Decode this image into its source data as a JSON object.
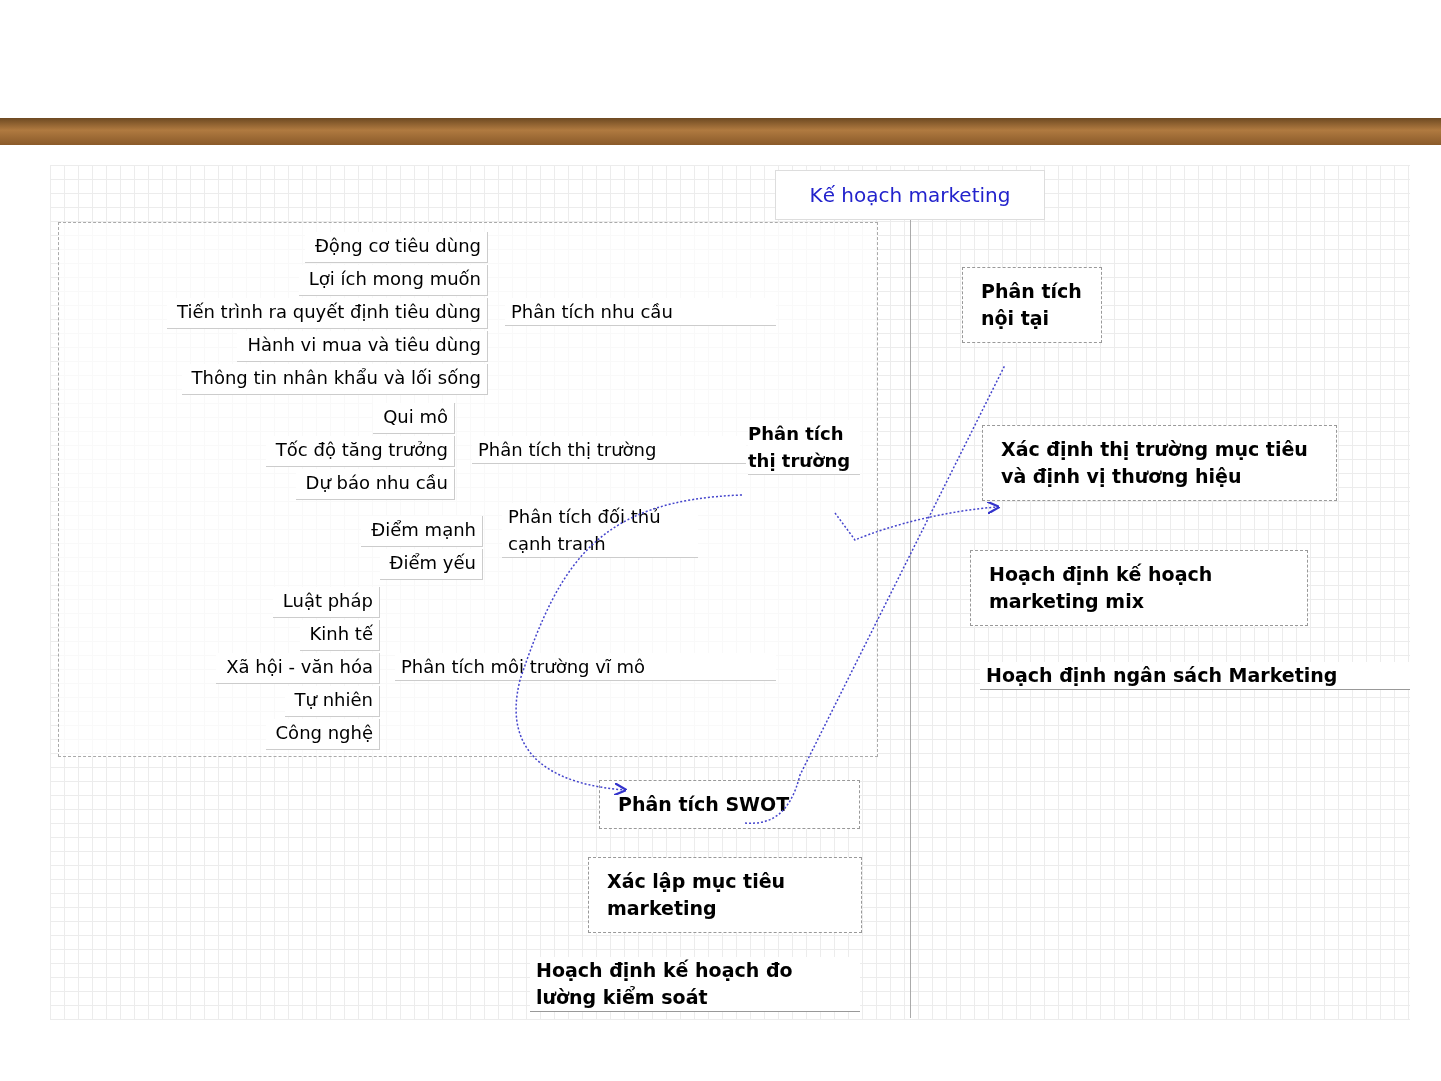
{
  "root": {
    "title": "Kế hoạch marketing"
  },
  "market_analysis": {
    "label": "Phân tích thị trường",
    "branches": [
      {
        "label": "Phân tích nhu cầu",
        "children": [
          "Động cơ tiêu dùng",
          "Lợi ích mong muốn",
          "Tiến trình ra quyết định tiêu dùng",
          "Hành vi mua và tiêu dùng",
          "Thông tin nhân khẩu và lối sống"
        ]
      },
      {
        "label": "Phân tích thị trường",
        "children": [
          "Qui mô",
          "Tốc độ tăng trưởng",
          "Dự báo nhu cầu"
        ]
      },
      {
        "label": "Phân tích đối thủ cạnh tranh",
        "children": [
          "Điểm mạnh",
          "Điểm yếu"
        ]
      },
      {
        "label": "Phân tích môi trường vĩ mô",
        "children": [
          "Luật pháp",
          "Kinh tế",
          "Xã hội - văn hóa",
          "Tự nhiên",
          "Công nghệ"
        ]
      }
    ]
  },
  "topics": [
    {
      "label": "Phân tích nội tại",
      "kind": "boxed"
    },
    {
      "label": "Xác định thị trường mục tiêu và định vị thương hiệu",
      "kind": "boxed"
    },
    {
      "label": "Hoạch định kế hoạch marketing mix",
      "kind": "boxed"
    },
    {
      "label": "Hoạch định ngân sách Marketing",
      "kind": "plain"
    },
    {
      "label": "Phân tích SWOT",
      "kind": "boxed"
    },
    {
      "label": "Xác lập mục tiêu marketing",
      "kind": "boxed"
    },
    {
      "label": "Hoạch định kế hoạch đo lường kiểm soát",
      "kind": "plain"
    }
  ]
}
